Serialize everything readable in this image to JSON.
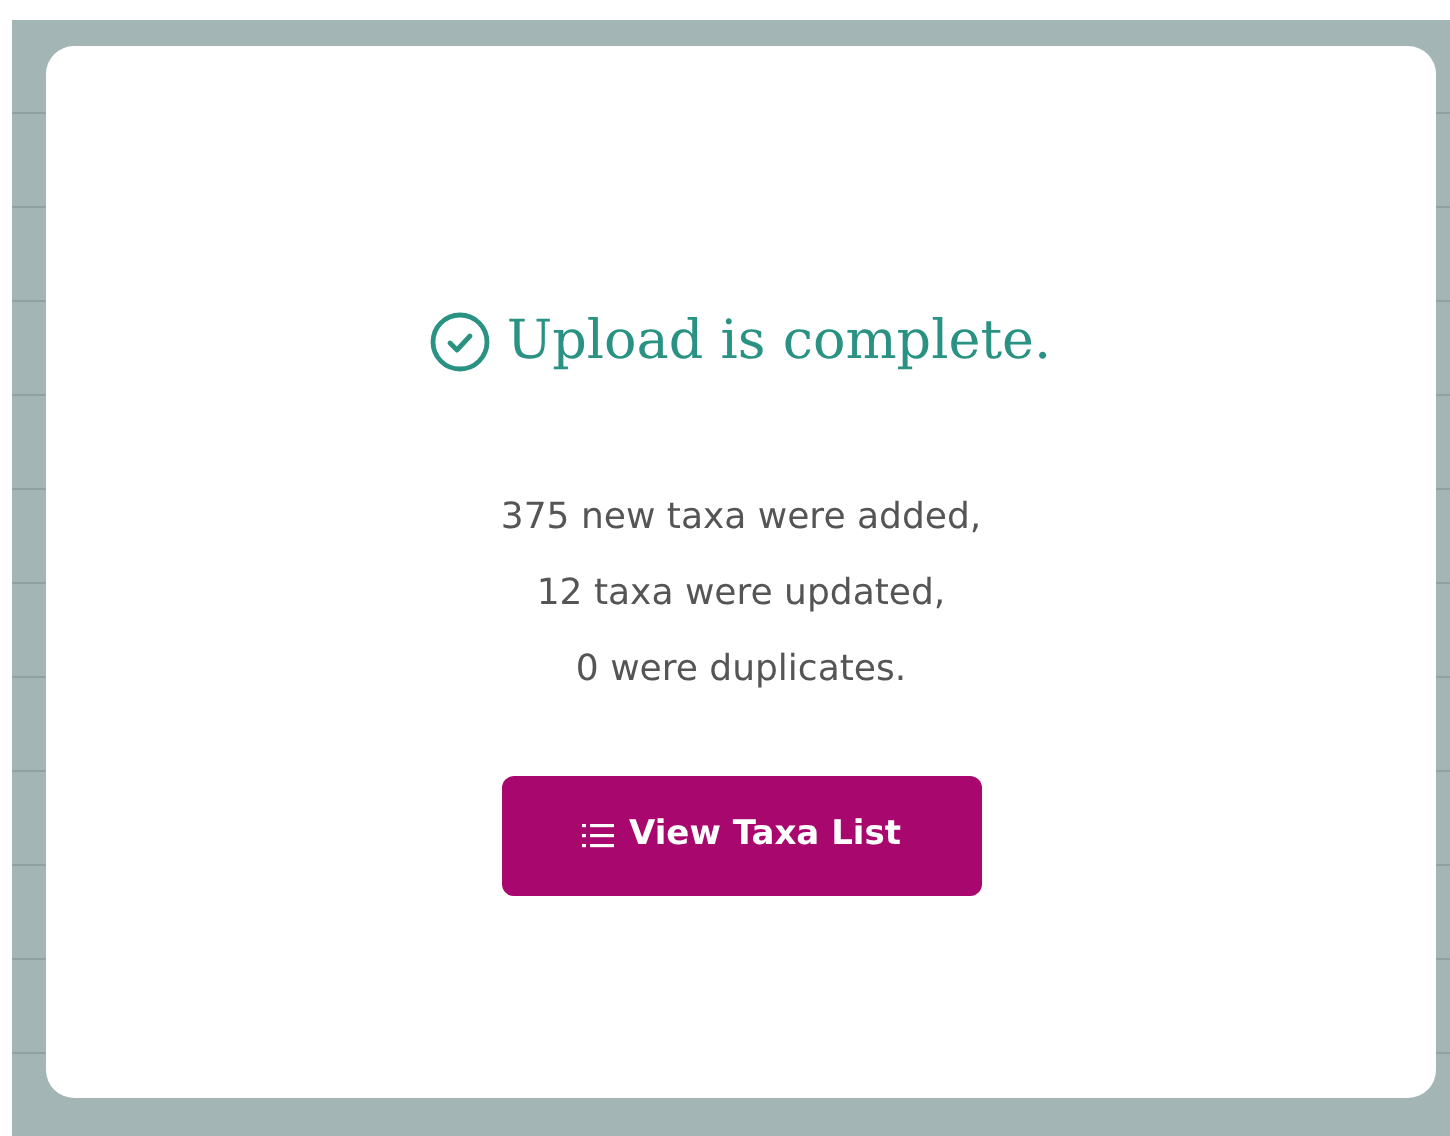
{
  "dialog": {
    "title": "Upload is complete.",
    "summary": [
      "375 new taxa were added,",
      "12 taxa were updated,",
      "0 were duplicates."
    ],
    "button": {
      "label": "View Taxa List"
    }
  }
}
